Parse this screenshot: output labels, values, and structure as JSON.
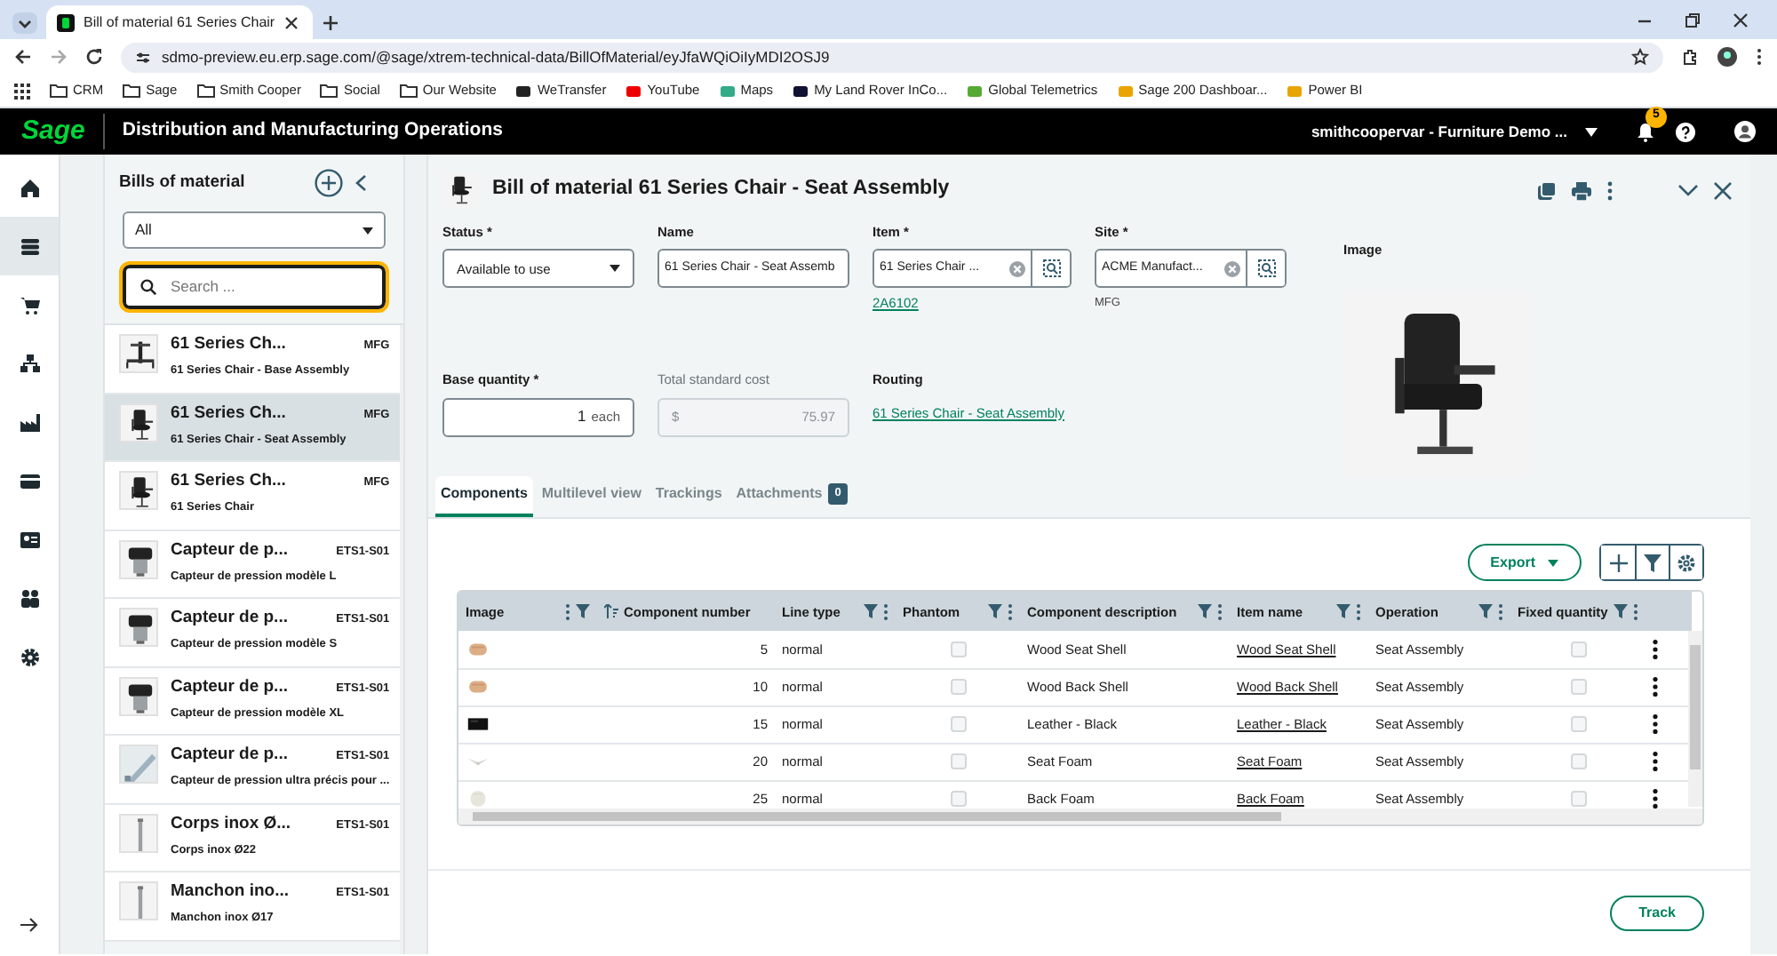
{
  "browser": {
    "tab_title": "Bill of material 61 Series Chair",
    "url": "sdmo-preview.eu.erp.sage.com/@sage/xtrem-technical-data/BillOfMaterial/eyJfaWQiOiIyMDI2OSJ9",
    "bookmarks": [
      {
        "label": "CRM",
        "kind": "folder"
      },
      {
        "label": "Sage",
        "kind": "folder"
      },
      {
        "label": "Smith Cooper",
        "kind": "folder"
      },
      {
        "label": "Social",
        "kind": "folder"
      },
      {
        "label": "Our Website",
        "kind": "folder"
      },
      {
        "label": "WeTransfer",
        "kind": "site"
      },
      {
        "label": "YouTube",
        "kind": "site"
      },
      {
        "label": "Maps",
        "kind": "site"
      },
      {
        "label": "My Land Rover InCo...",
        "kind": "site"
      },
      {
        "label": "Global Telemetrics",
        "kind": "site"
      },
      {
        "label": "Sage 200 Dashboar...",
        "kind": "site"
      },
      {
        "label": "Power BI",
        "kind": "site"
      }
    ]
  },
  "app": {
    "logo": "Sage",
    "title": "Distribution and Manufacturing Operations",
    "account": "smithcoopervar - Furniture Demo ...",
    "notifications": "5"
  },
  "rail": [
    {
      "selected": false
    },
    {
      "selected": true
    },
    {
      "selected": false
    },
    {
      "selected": false
    },
    {
      "selected": false
    },
    {
      "selected": false
    },
    {
      "selected": false
    },
    {
      "selected": false
    },
    {
      "selected": false
    }
  ],
  "list": {
    "title": "Bills of material",
    "filter": "All",
    "search_placeholder": "Search ...",
    "items": [
      {
        "title": "61 Series Ch...",
        "code": "MFG",
        "subtitle": "61 Series Chair - Base Assembly",
        "selected": false
      },
      {
        "title": "61 Series Ch...",
        "code": "MFG",
        "subtitle": "61 Series Chair - Seat Assembly",
        "selected": true
      },
      {
        "title": "61 Series Ch...",
        "code": "MFG",
        "subtitle": "61 Series Chair",
        "selected": false
      },
      {
        "title": "Capteur de p...",
        "code": "ETS1-S01",
        "subtitle": "Capteur de pression modèle L",
        "selected": false
      },
      {
        "title": "Capteur de p...",
        "code": "ETS1-S01",
        "subtitle": "Capteur de pression modèle S",
        "selected": false
      },
      {
        "title": "Capteur de p...",
        "code": "ETS1-S01",
        "subtitle": "Capteur de pression modèle XL",
        "selected": false
      },
      {
        "title": "Capteur de p...",
        "code": "ETS1-S01",
        "subtitle": "Capteur de pression ultra précis pour ...",
        "selected": false
      },
      {
        "title": "Corps inox Ø...",
        "code": "ETS1-S01",
        "subtitle": "Corps inox Ø22",
        "selected": false
      },
      {
        "title": "Manchon ino...",
        "code": "ETS1-S01",
        "subtitle": "Manchon inox Ø17",
        "selected": false
      }
    ]
  },
  "record": {
    "title": "Bill of material 61 Series Chair - Seat Assembly",
    "status": {
      "label": "Status *",
      "value": "Available to use"
    },
    "name": {
      "label": "Name",
      "value": "61 Series Chair - Seat Assemb"
    },
    "item": {
      "label": "Item *",
      "value": "61 Series Chair ...",
      "link": "2A6102"
    },
    "site": {
      "label": "Site *",
      "value": "ACME Manufact...",
      "note": "MFG"
    },
    "base_quantity": {
      "label": "Base quantity *",
      "value": "1",
      "unit": "each"
    },
    "total_cost": {
      "label": "Total standard cost",
      "currency": "$",
      "value": "75.97",
      "disabled": true
    },
    "routing": {
      "label": "Routing",
      "link": "61 Series Chair - Seat Assembly"
    },
    "image": {
      "label": "Image"
    }
  },
  "tabs": [
    {
      "label": "Components",
      "selected": true
    },
    {
      "label": "Multilevel view",
      "selected": false
    },
    {
      "label": "Trackings",
      "selected": false
    },
    {
      "label": "Attachments",
      "count": "0",
      "selected": false
    }
  ],
  "export": {
    "label": "Export"
  },
  "table": {
    "columns": [
      "Image",
      "Component number",
      "Line type",
      "Phantom",
      "Component description",
      "Item name",
      "Operation",
      "Fixed quantity"
    ],
    "rows": [
      {
        "number": "5",
        "line_type": "normal",
        "phantom": false,
        "description": "Wood Seat Shell",
        "item_name": "Wood Seat Shell",
        "operation": "Seat Assembly",
        "fixed_quantity": false
      },
      {
        "number": "10",
        "line_type": "normal",
        "phantom": false,
        "description": "Wood Back Shell",
        "item_name": "Wood Back Shell",
        "operation": "Seat Assembly",
        "fixed_quantity": false
      },
      {
        "number": "15",
        "line_type": "normal",
        "phantom": false,
        "description": "Leather - Black",
        "item_name": "Leather - Black",
        "operation": "Seat Assembly",
        "fixed_quantity": false
      },
      {
        "number": "20",
        "line_type": "normal",
        "phantom": false,
        "description": "Seat Foam",
        "item_name": "Seat Foam",
        "operation": "Seat Assembly",
        "fixed_quantity": false
      },
      {
        "number": "25",
        "line_type": "normal",
        "phantom": false,
        "description": "Back Foam",
        "item_name": "Back Foam",
        "operation": "Seat Assembly",
        "fixed_quantity": false
      }
    ]
  },
  "track": {
    "label": "Track"
  }
}
